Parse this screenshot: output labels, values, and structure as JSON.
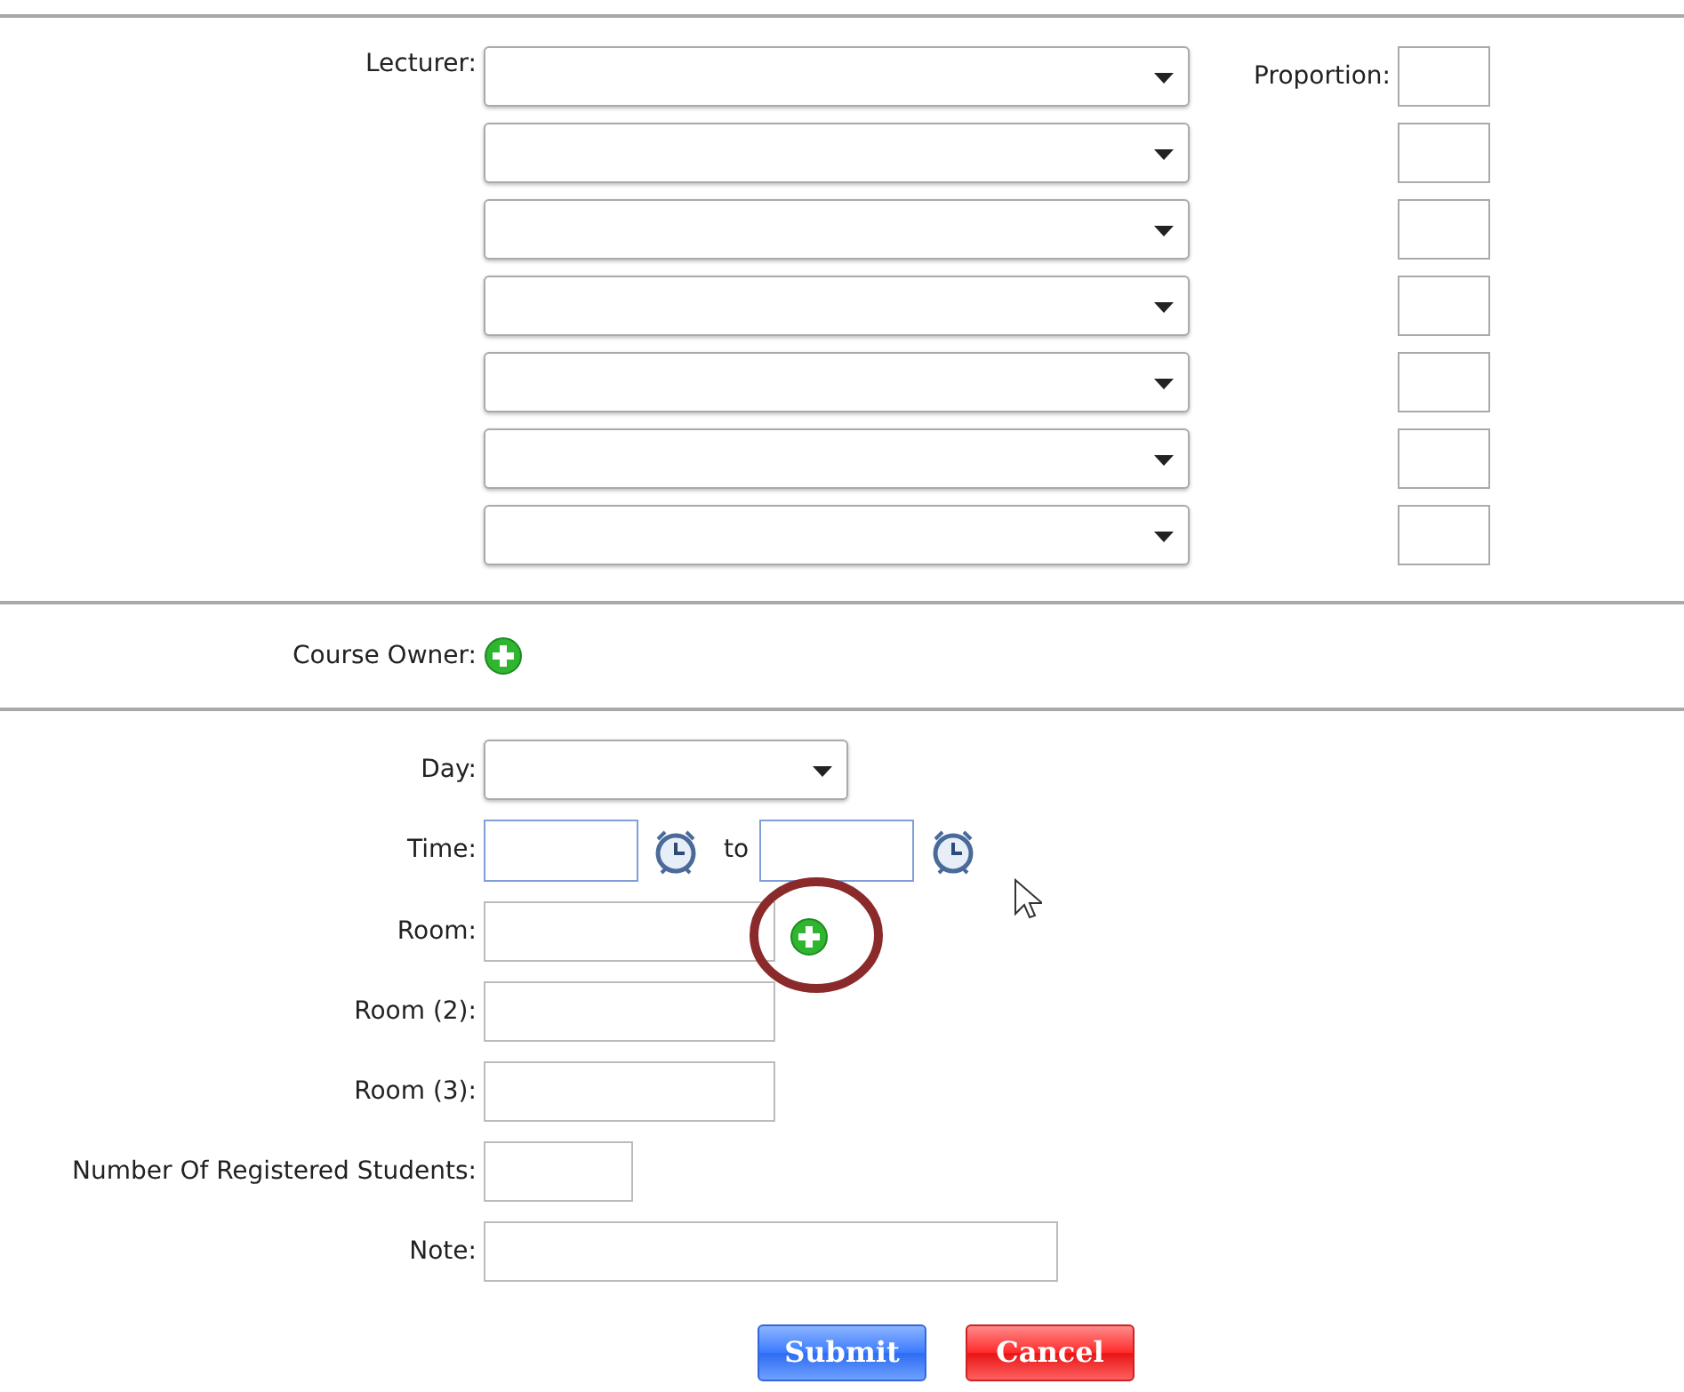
{
  "lecturer": {
    "label": "Lecturer:",
    "proportion_label": "Proportion:",
    "rows": [
      {
        "kind": "select-proportion"
      },
      {
        "kind": "select-proportion"
      },
      {
        "kind": "select-proportion"
      },
      {
        "kind": "select-proportion"
      },
      {
        "kind": "select-proportion"
      },
      {
        "kind": "select-proportion"
      },
      {
        "kind": "select-proportion"
      }
    ]
  },
  "course_owner": {
    "label": "Course Owner:"
  },
  "fields": [
    {
      "kind": "select",
      "label": "Day:"
    },
    {
      "kind": "time-range",
      "label": "Time:",
      "separator": "to"
    },
    {
      "kind": "text-add",
      "label": "Room:",
      "highlighted": true
    },
    {
      "kind": "text",
      "label": "Room (2):"
    },
    {
      "kind": "text",
      "label": "Room (3):"
    },
    {
      "kind": "short",
      "label": "Number Of Registered Students:"
    },
    {
      "kind": "wide",
      "label": "Note:"
    }
  ],
  "buttons": [
    {
      "label": "Submit",
      "kind": "primary"
    },
    {
      "label": "Cancel",
      "kind": "danger"
    }
  ]
}
